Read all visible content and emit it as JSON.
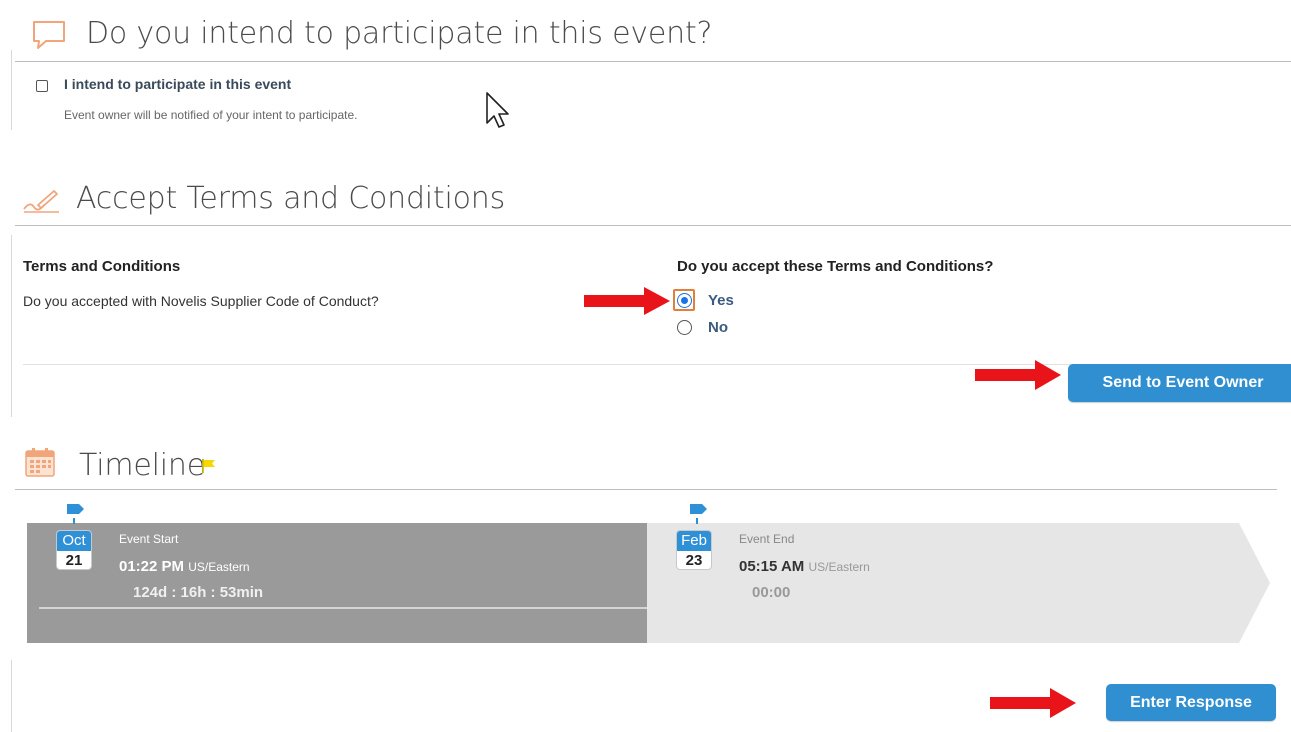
{
  "participate": {
    "title": "Do you intend to participate in this event?",
    "checkbox_label": "I intend to participate in this event",
    "checkbox_checked": false,
    "note": "Event owner will be notified of your intent to participate."
  },
  "terms": {
    "title": "Accept Terms and Conditions",
    "column_header": "Terms and Conditions",
    "question_header": "Do you accept these Terms and Conditions?",
    "item_text": "Do you accepted with Novelis Supplier Code of Conduct?",
    "options": [
      {
        "label": "Yes",
        "selected": true
      },
      {
        "label": "No",
        "selected": false
      }
    ],
    "send_button": "Send to Event Owner"
  },
  "timeline": {
    "title": "Timeline",
    "start": {
      "month": "Oct",
      "day": "21",
      "label": "Event Start",
      "time": "01:22 PM",
      "timezone": "US/Eastern",
      "countdown": "124d : 16h : 53min"
    },
    "end": {
      "month": "Feb",
      "day": "23",
      "label": "Event End",
      "time": "05:15 AM",
      "timezone": "US/Eastern",
      "countdown": "00:00"
    }
  },
  "footer": {
    "enter_button": "Enter Response"
  },
  "colors": {
    "accent_blue": "#2f8fd0",
    "arrow_red": "#e8141a",
    "icon_orange": "#f2a57a",
    "flag_yellow": "#f5d800",
    "timeline_active": "#9a9a9a",
    "timeline_future": "#e6e6e6"
  }
}
